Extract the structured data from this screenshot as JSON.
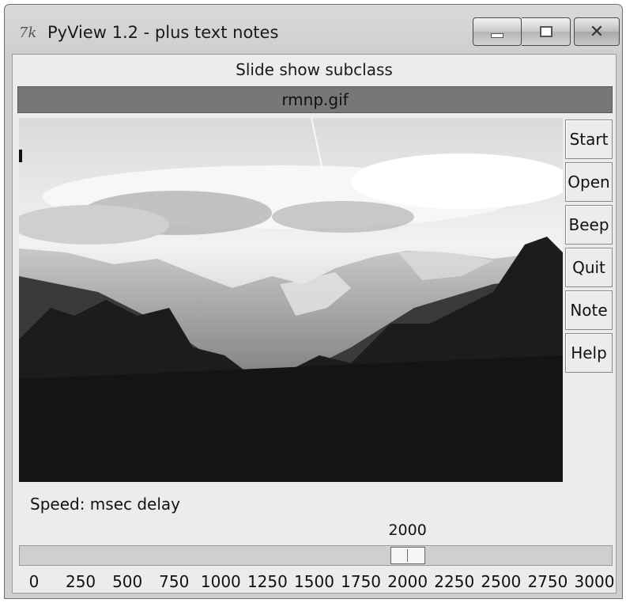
{
  "window": {
    "title": "PyView 1.2 - plus text notes",
    "app_icon": "tk-feather-icon",
    "buttons": [
      "minimize-icon",
      "maximize-icon",
      "close-icon"
    ]
  },
  "header": {
    "label": "Slide show subclass"
  },
  "image": {
    "filename": "rmnp.gif"
  },
  "side_buttons": [
    {
      "label": "Start"
    },
    {
      "label": "Open"
    },
    {
      "label": "Beep"
    },
    {
      "label": "Quit"
    },
    {
      "label": "Note"
    },
    {
      "label": "Help"
    }
  ],
  "speed": {
    "label": "Speed: msec delay",
    "value": "2000",
    "min": 0,
    "max": 3000,
    "ticks": [
      "0",
      "250",
      "500",
      "750",
      "1000",
      "1250",
      "1500",
      "1750",
      "2000",
      "2250",
      "2500",
      "2750",
      "3000"
    ]
  },
  "colors": {
    "filename_bar": "#777777",
    "client_bg": "#ececec"
  }
}
